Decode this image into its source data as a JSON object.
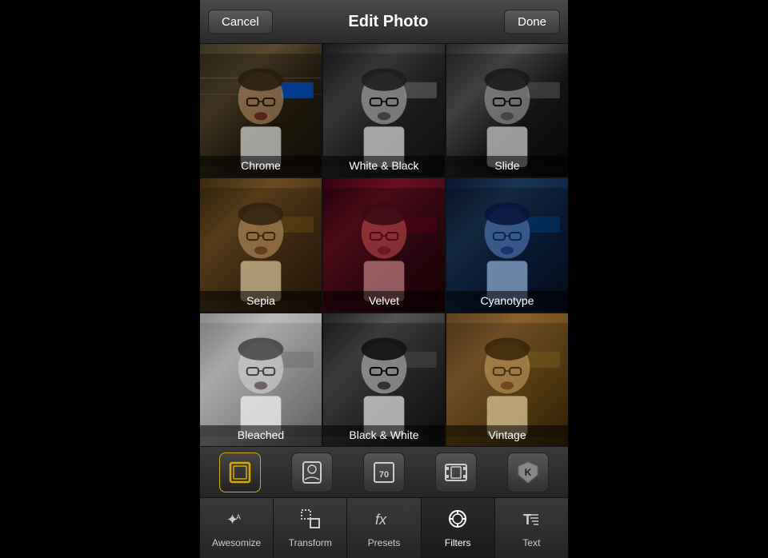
{
  "header": {
    "cancel_label": "Cancel",
    "title": "Edit Photo",
    "done_label": "Done"
  },
  "filters": [
    {
      "id": "chrome",
      "label": "Chrome",
      "class": "filter-chrome"
    },
    {
      "id": "wb",
      "label": "White & Black",
      "class": "filter-wb"
    },
    {
      "id": "slide",
      "label": "Slide",
      "class": "filter-slide"
    },
    {
      "id": "sepia",
      "label": "Sepia",
      "class": "filter-sepia"
    },
    {
      "id": "velvet",
      "label": "Velvet",
      "class": "filter-velvet"
    },
    {
      "id": "cyanotype",
      "label": "Cyanotype",
      "class": "filter-cyanotype"
    },
    {
      "id": "bleached",
      "label": "Bleached",
      "class": "filter-bleached"
    },
    {
      "id": "bw",
      "label": "Black & White",
      "class": "filter-bw"
    },
    {
      "id": "vintage",
      "label": "Vintage",
      "class": "filter-vintage"
    }
  ],
  "toolbar": {
    "icons": [
      "frame",
      "portrait",
      "preset70",
      "film",
      "k-shield"
    ]
  },
  "nav": {
    "items": [
      {
        "id": "awesomize",
        "label": "Awesomize",
        "icon": "✦"
      },
      {
        "id": "transform",
        "label": "Transform",
        "icon": "⊞"
      },
      {
        "id": "presets",
        "label": "Presets",
        "icon": "ƒx"
      },
      {
        "id": "filters",
        "label": "Filters",
        "icon": "◎",
        "active": true
      },
      {
        "id": "text",
        "label": "Text",
        "icon": "T"
      }
    ]
  }
}
